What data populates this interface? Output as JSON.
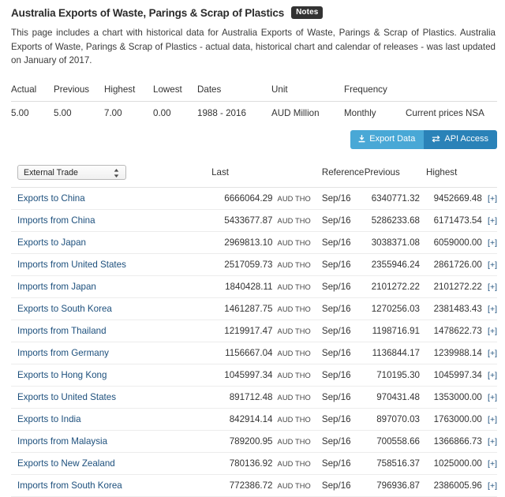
{
  "header": {
    "title": "Australia Exports of Waste, Parings & Scrap of Plastics",
    "notes_label": "Notes"
  },
  "intro": {
    "text": "This page includes a chart with historical data for Australia Exports of Waste, Parings & Scrap of Plastics. Australia Exports of Waste, Parings & Scrap of Plastics - actual data, historical chart and calendar of releases - was last updated on January of 2017."
  },
  "stats": {
    "columns": [
      "Actual",
      "Previous",
      "Highest",
      "Lowest",
      "Dates",
      "Unit",
      "Frequency",
      ""
    ],
    "values": [
      "5.00",
      "5.00",
      "7.00",
      "0.00",
      "1988 - 2016",
      "AUD Million",
      "Monthly",
      "Current prices NSA"
    ]
  },
  "toolbar": {
    "export_label": "Export Data",
    "api_label": "API Access",
    "export_color": "#49a8d6",
    "api_color": "#2a82b8"
  },
  "selector": {
    "selected": "External Trade"
  },
  "table": {
    "columns": {
      "last": "Last",
      "reference": "Reference",
      "previous": "Previous",
      "highest": "Highest"
    },
    "expand_label": "[+]",
    "rows": [
      {
        "name": "Exports to China",
        "last": "6666064.29",
        "unit": "AUD THO",
        "reference": "Sep/16",
        "previous": "6340771.32",
        "highest": "9452669.48"
      },
      {
        "name": "Imports from China",
        "last": "5433677.87",
        "unit": "AUD THO",
        "reference": "Sep/16",
        "previous": "5286233.68",
        "highest": "6171473.54"
      },
      {
        "name": "Exports to Japan",
        "last": "2969813.10",
        "unit": "AUD THO",
        "reference": "Sep/16",
        "previous": "3038371.08",
        "highest": "6059000.00"
      },
      {
        "name": "Imports from United States",
        "last": "2517059.73",
        "unit": "AUD THO",
        "reference": "Sep/16",
        "previous": "2355946.24",
        "highest": "2861726.00"
      },
      {
        "name": "Imports from Japan",
        "last": "1840428.11",
        "unit": "AUD THO",
        "reference": "Sep/16",
        "previous": "2101272.22",
        "highest": "2101272.22"
      },
      {
        "name": "Exports to South Korea",
        "last": "1461287.75",
        "unit": "AUD THO",
        "reference": "Sep/16",
        "previous": "1270256.03",
        "highest": "2381483.43"
      },
      {
        "name": "Imports from Thailand",
        "last": "1219917.47",
        "unit": "AUD THO",
        "reference": "Sep/16",
        "previous": "1198716.91",
        "highest": "1478622.73"
      },
      {
        "name": "Imports from Germany",
        "last": "1156667.04",
        "unit": "AUD THO",
        "reference": "Sep/16",
        "previous": "1136844.17",
        "highest": "1239988.14"
      },
      {
        "name": "Exports to Hong Kong",
        "last": "1045997.34",
        "unit": "AUD THO",
        "reference": "Sep/16",
        "previous": "710195.30",
        "highest": "1045997.34"
      },
      {
        "name": "Exports to United States",
        "last": "891712.48",
        "unit": "AUD THO",
        "reference": "Sep/16",
        "previous": "970431.48",
        "highest": "1353000.00"
      },
      {
        "name": "Exports to India",
        "last": "842914.14",
        "unit": "AUD THO",
        "reference": "Sep/16",
        "previous": "897070.03",
        "highest": "1763000.00"
      },
      {
        "name": "Imports from Malaysia",
        "last": "789200.95",
        "unit": "AUD THO",
        "reference": "Sep/16",
        "previous": "700558.66",
        "highest": "1366866.73"
      },
      {
        "name": "Exports to New Zealand",
        "last": "780136.92",
        "unit": "AUD THO",
        "reference": "Sep/16",
        "previous": "758516.37",
        "highest": "1025000.00"
      },
      {
        "name": "Imports from South Korea",
        "last": "772386.72",
        "unit": "AUD THO",
        "reference": "Sep/16",
        "previous": "796936.87",
        "highest": "2386005.96"
      }
    ]
  }
}
